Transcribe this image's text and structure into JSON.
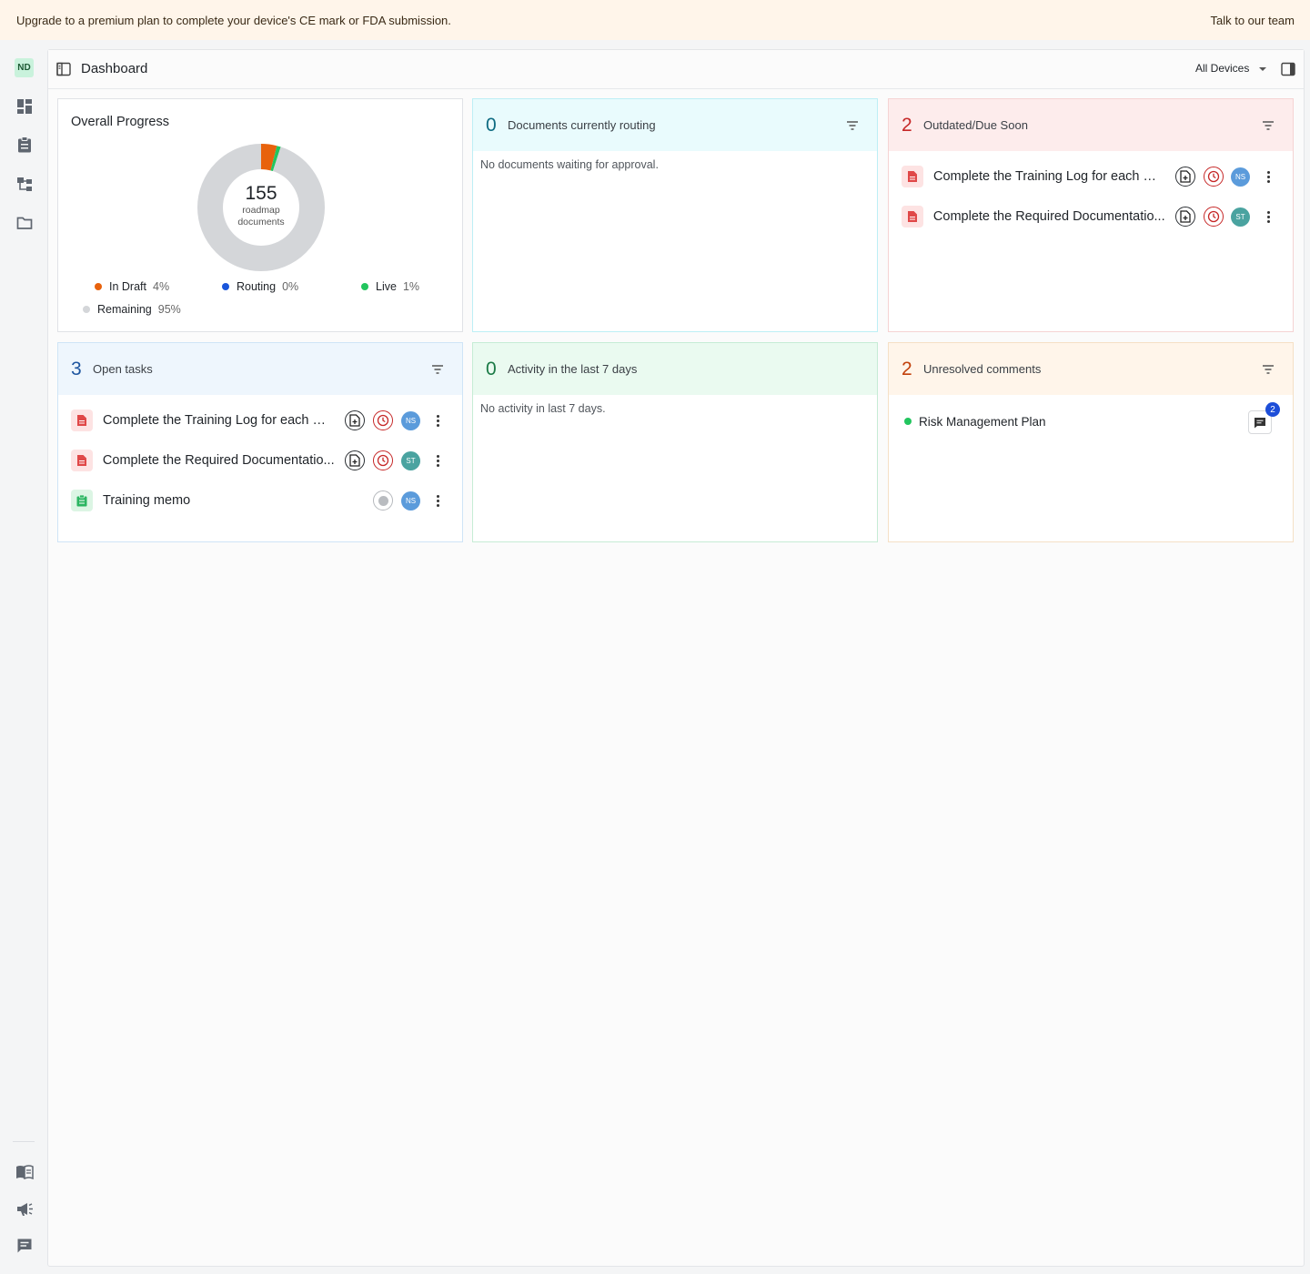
{
  "banner": {
    "message": "Upgrade to a premium plan to complete your device's CE mark or FDA submission.",
    "cta": "Talk to our team"
  },
  "rail": {
    "user_initials": "ND"
  },
  "header": {
    "title": "Dashboard",
    "device_select": "All Devices"
  },
  "progress": {
    "title": "Overall Progress",
    "total": "155",
    "total_caption_1": "roadmap",
    "total_caption_2": "documents",
    "legend": [
      {
        "name": "In Draft",
        "pct": "4%",
        "value": 4,
        "color": "#e8620c"
      },
      {
        "name": "Routing",
        "pct": "0%",
        "value": 0,
        "color": "#1a56db"
      },
      {
        "name": "Live",
        "pct": "1%",
        "value": 1,
        "color": "#22c55e"
      },
      {
        "name": "Remaining",
        "pct": "95%",
        "value": 95,
        "color": "#d4d6d9"
      }
    ]
  },
  "routing": {
    "count": "0",
    "label": "Documents currently routing",
    "empty": "No documents waiting for approval.",
    "color": "#0e6b82",
    "bg": "#e9fbfd"
  },
  "outdated": {
    "count": "2",
    "label": "Outdated/Due Soon",
    "color": "#c62828",
    "bg": "#fdecec",
    "items": [
      {
        "title": "Complete the Training Log for each e...",
        "assignee": "NS"
      },
      {
        "title": "Complete the Required Documentatio...",
        "assignee": "ST"
      }
    ]
  },
  "tasks": {
    "count": "3",
    "label": "Open tasks",
    "color": "#1e56a0",
    "bg": "#eef6fd",
    "items": [
      {
        "title": "Complete the Training Log for each e...",
        "assignee": "NS"
      },
      {
        "title": "Complete the Required Documentatio...",
        "assignee": "ST"
      },
      {
        "title": "Training memo",
        "assignee": "NS"
      }
    ]
  },
  "activity": {
    "count": "0",
    "label": "Activity in the last 7 days",
    "empty": "No activity in last 7 days.",
    "color": "#1b7a46",
    "bg": "#eafaf0"
  },
  "comments": {
    "count": "2",
    "label": "Unresolved comments",
    "color": "#c2410c",
    "bg": "#fff5ea",
    "items": [
      {
        "title": "Risk Management Plan",
        "badge": "2"
      }
    ]
  }
}
